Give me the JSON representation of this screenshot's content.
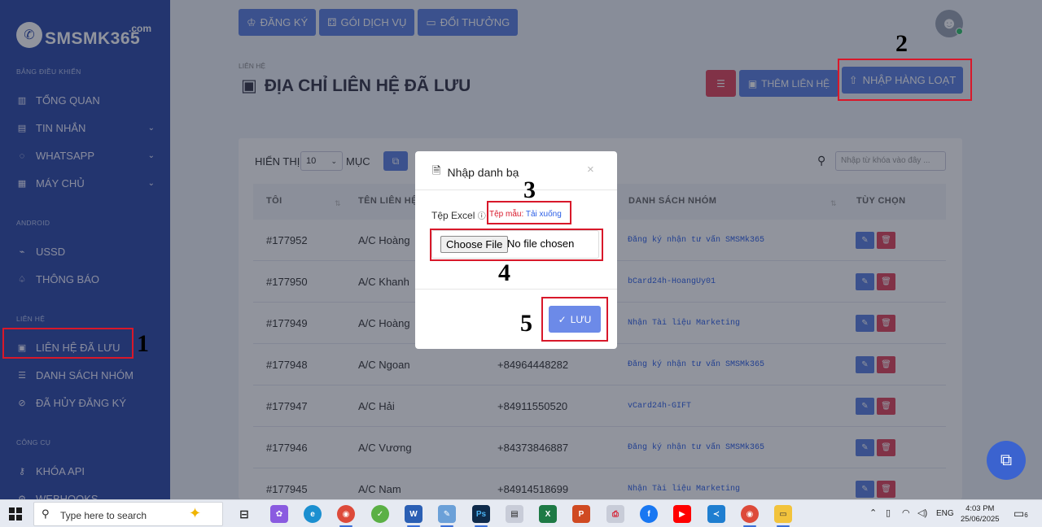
{
  "sidebar": {
    "logo": "SMSMK365",
    "logo_com": ".com",
    "sections": {
      "dashboard": "BẢNG ĐIỀU KHIỂN",
      "android": "ANDROID",
      "contacts": "LIÊN HỆ",
      "tools": "CÔNG CỤ"
    },
    "items": {
      "overview": "TỔNG QUAN",
      "messages": "TIN NHẮN",
      "whatsapp": "WHATSAPP",
      "server": "MÁY CHỦ",
      "ussd": "USSD",
      "notify": "THÔNG BÁO",
      "saved": "LIÊN HỆ ĐÃ LƯU",
      "groups": "DANH SÁCH NHÓM",
      "unsub": "ĐÃ HỦY ĐĂNG KÝ",
      "api": "KHÓA API",
      "webhooks": "WEBHOOKS"
    }
  },
  "topbar": {
    "register": "ĐĂNG KÝ",
    "packages": "GÓI DỊCH VỤ",
    "rewards": "ĐỔI THƯỞNG"
  },
  "page": {
    "breadcrumb": "LIÊN HỆ",
    "title": "ĐỊA CHỈ LIÊN HỆ ĐÃ LƯU",
    "add_contact": "THÊM LIÊN HỆ",
    "bulk_import": "NHẬP HÀNG LOẠT"
  },
  "table": {
    "show_label": "HIỂN THỊ",
    "show_value": "10",
    "entries_label": "MỤC",
    "search_placeholder": "Nhập từ khóa vào đây ...",
    "headers": {
      "id": "TÔI",
      "name": "TÊN LIÊN HỆ",
      "groups": "DANH SÁCH NHÓM",
      "options": "TÙY CHỌN"
    },
    "rows": [
      {
        "id": "#177952",
        "name": "A/C Hoàng",
        "phone": "",
        "group": "Đăng ký nhận tư vấn SMSMk365"
      },
      {
        "id": "#177950",
        "name": "A/C Khanh",
        "phone": "",
        "group": "bCard24h-HoangUy01"
      },
      {
        "id": "#177949",
        "name": "A/C Hoàng",
        "phone": "",
        "group": "Nhận Tài liệu Marketing"
      },
      {
        "id": "#177948",
        "name": "A/C Ngoan",
        "phone": "+84964448282",
        "group": "Đăng ký nhận tư vấn SMSMk365"
      },
      {
        "id": "#177947",
        "name": "A/C Hải",
        "phone": "+84911550520",
        "group": "vCard24h-GIFT"
      },
      {
        "id": "#177946",
        "name": "A/C Vương",
        "phone": "+84373846887",
        "group": "Đăng ký nhận tư vấn SMSMk365"
      },
      {
        "id": "#177945",
        "name": "A/C Nam",
        "phone": "+84914518699",
        "group": "Nhận Tài liệu Marketing"
      }
    ]
  },
  "modal": {
    "title": "Nhập danh bạ",
    "close": "×",
    "label": "Tệp Excel",
    "sample_prefix": "Tệp mẫu:",
    "sample_link": "Tải xuống",
    "choose_file": "Choose File",
    "no_file": "No file chosen",
    "save": "LƯU"
  },
  "annotations": {
    "n1": "1",
    "n2": "2",
    "n3": "3",
    "n4": "4",
    "n5": "5"
  },
  "taskbar": {
    "search": "Type here to search",
    "lang": "ENG",
    "time": "4:03 PM",
    "date": "25/06/2025",
    "notif_count": "6"
  },
  "colors": {
    "sidebar": "#2c4aa8",
    "primary": "#5b7fe0",
    "danger": "#e0435a",
    "annotation": "#d8182a"
  }
}
